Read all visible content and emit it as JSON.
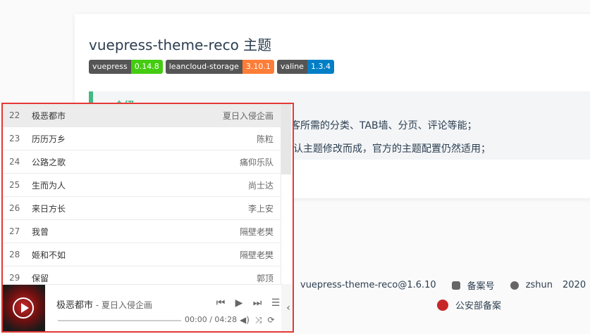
{
  "page": {
    "title": "vuepress-theme-reco 主题",
    "badges": [
      {
        "left": "vuepress",
        "right": "0.14.8",
        "color": "#4c1"
      },
      {
        "left": "leancloud-storage",
        "right": "3.10.1",
        "color": "#fe7d37"
      },
      {
        "left": "valine",
        "right": "1.3.4",
        "color": "#007ec6"
      }
    ],
    "tip": {
      "title": "介绍",
      "line1": "加博客所需的分类、TAB墙、分页、评论等能；",
      "line2": "默认主题修改而成，官方的主题配置仍然适用；"
    }
  },
  "footer": {
    "theme_link": "vuepress-theme-reco@1.6.10",
    "record": "备案号",
    "author": "zshun",
    "year": "2020",
    "police": "公安部备案"
  },
  "player": {
    "playlist": [
      {
        "index": "22",
        "name": "极恶都市",
        "artist": "夏日入侵企画"
      },
      {
        "index": "23",
        "name": "历历万乡",
        "artist": "陈粒"
      },
      {
        "index": "24",
        "name": "公路之歌",
        "artist": "痛仰乐队"
      },
      {
        "index": "25",
        "name": "生而为人",
        "artist": "尚士达"
      },
      {
        "index": "26",
        "name": "来日方长",
        "artist": "李上安"
      },
      {
        "index": "27",
        "name": "我曾",
        "artist": "隔壁老樊"
      },
      {
        "index": "28",
        "name": "姬和不如",
        "artist": "隔壁老樊"
      },
      {
        "index": "29",
        "name": "保留",
        "artist": "郭顶"
      }
    ],
    "now_playing": {
      "title": "极恶都市",
      "separator": " - ",
      "artist": "夏日入侵企画"
    },
    "time": "00:00 / 04:28",
    "progress": 0,
    "accent": "#e53935"
  }
}
